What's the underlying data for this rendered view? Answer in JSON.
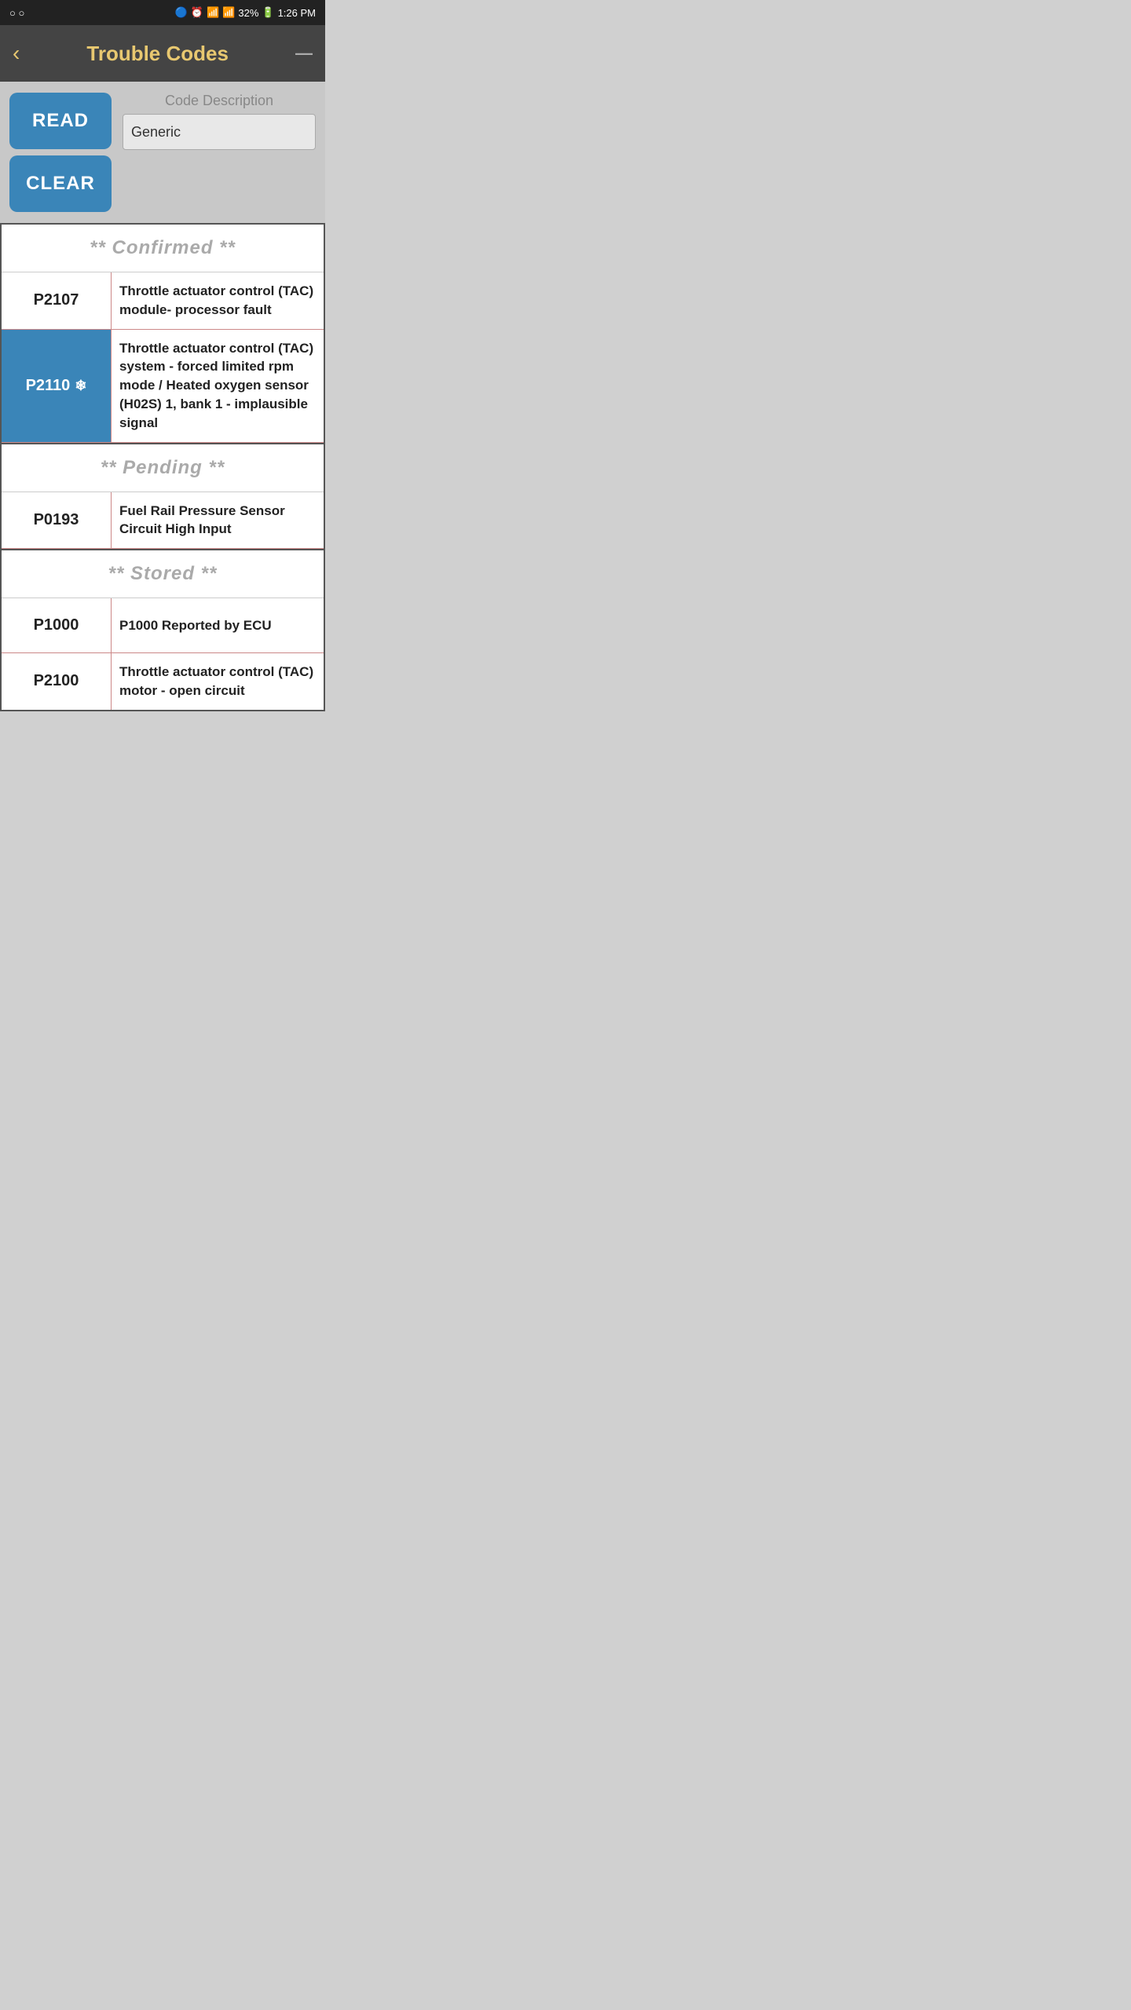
{
  "status_bar": {
    "left": "○ ○",
    "right_items": [
      "🔵",
      "⏰",
      "WiFi",
      "📶",
      "32%",
      "🔋",
      "1:26 PM"
    ]
  },
  "header": {
    "back_label": "‹",
    "title": "Trouble Codes",
    "menu_label": "—"
  },
  "controls": {
    "read_button_label": "READ",
    "clear_button_label": "CLEAR",
    "code_description_label": "Code Description",
    "code_description_value": "Generic",
    "code_description_placeholder": "Generic"
  },
  "sections": [
    {
      "id": "confirmed",
      "header": "** Confirmed **",
      "rows": [
        {
          "code": "P2107",
          "description": "Throttle actuator control (TAC) module- processor fault",
          "highlighted": false,
          "has_snowflake": false
        },
        {
          "code": "P2110",
          "description": "Throttle actuator control (TAC) system - forced limited rpm mode / Heated oxygen sensor (H02S) 1, bank 1 - implausible signal",
          "highlighted": true,
          "has_snowflake": true
        }
      ]
    },
    {
      "id": "pending",
      "header": "** Pending **",
      "rows": [
        {
          "code": "P0193",
          "description": "Fuel Rail Pressure Sensor Circuit High Input",
          "highlighted": false,
          "has_snowflake": false
        }
      ]
    },
    {
      "id": "stored",
      "header": "** Stored **",
      "rows": [
        {
          "code": "P1000",
          "description": "P1000 Reported by ECU",
          "highlighted": false,
          "has_snowflake": false
        },
        {
          "code": "P2100",
          "description": "Throttle actuator control (TAC) motor - open circuit",
          "highlighted": false,
          "has_snowflake": false
        }
      ]
    }
  ],
  "icons": {
    "snowflake": "❄",
    "back_arrow": "‹",
    "minimize": "—"
  }
}
